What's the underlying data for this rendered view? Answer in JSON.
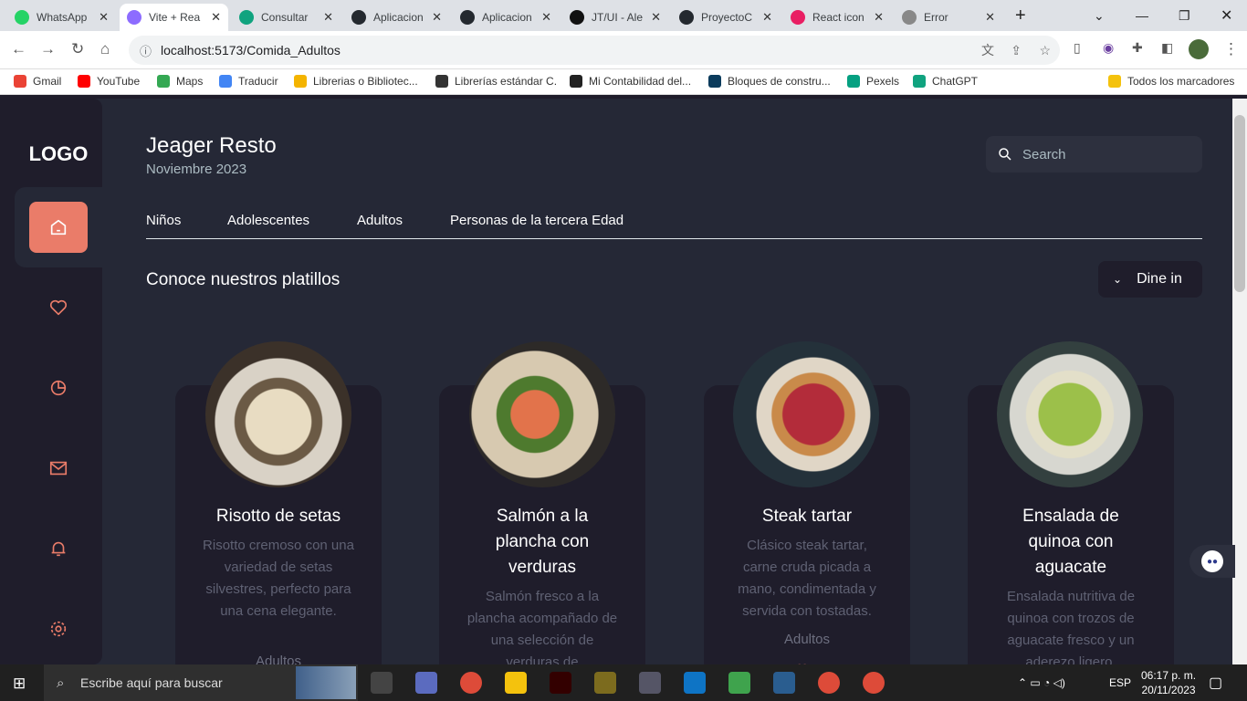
{
  "browser": {
    "tabs": [
      {
        "label": "WhatsApp",
        "color": "#25d366"
      },
      {
        "label": "Vite + Rea",
        "color": "#8d6cff"
      },
      {
        "label": "Consultar",
        "color": "#10a37f"
      },
      {
        "label": "Aplicacion",
        "color": "#24292f"
      },
      {
        "label": "Aplicacion",
        "color": "#24292f"
      },
      {
        "label": "JT/UI - Ale",
        "color": "#111111"
      },
      {
        "label": "ProyectoC",
        "color": "#24292f"
      },
      {
        "label": "React icon",
        "color": "#e91e63"
      },
      {
        "label": "Error",
        "color": "#888888"
      }
    ],
    "url": "localhost:5173/Comida_Adultos",
    "bookmarks": [
      {
        "label": "Gmail",
        "color": "#ea4335"
      },
      {
        "label": "YouTube",
        "color": "#ff0000"
      },
      {
        "label": "Maps",
        "color": "#34a853"
      },
      {
        "label": "Traducir",
        "color": "#4285f4"
      },
      {
        "label": "Librerias o Bibliotec...",
        "color": "#f4b400"
      },
      {
        "label": "Librerías estándar C.",
        "color": "#333333"
      },
      {
        "label": "Mi Contabilidad del...",
        "color": "#222222"
      },
      {
        "label": "Bloques de constru...",
        "color": "#0b3b5c"
      },
      {
        "label": "Pexels",
        "color": "#05a081"
      },
      {
        "label": "ChatGPT",
        "color": "#10a37f"
      }
    ],
    "all_bookmarks": "Todos los marcadores"
  },
  "app": {
    "logo": "LOGO",
    "title": "Jeager Resto",
    "date": "Noviembre 2023",
    "search_placeholder": "Search",
    "nav": [
      "Niños",
      "Adolescentes",
      "Adultos",
      "Personas de la tercera Edad"
    ],
    "section_title": "Conoce nuestros platillos",
    "dine_label": "Dine in",
    "dishes": [
      {
        "name": "Risotto de setas",
        "desc": "Risotto cremoso con una variedad de setas silvestres, perfecto para una cena elegante.",
        "category": "Adultos"
      },
      {
        "name": "Salmón a la plancha con verduras",
        "desc": "Salmón fresco a la plancha acompañado de una selección de verduras de",
        "category": ""
      },
      {
        "name": "Steak tartar",
        "desc": "Clásico steak tartar, carne cruda picada a mano, condimentada y servida con tostadas.",
        "category": "Adultos"
      },
      {
        "name": "Ensalada de quinoa con aguacate",
        "desc": "Ensalada nutritiva de quinoa con trozos de aguacate fresco y un aderezo ligero.",
        "category": ""
      }
    ],
    "accent": "#ea7c69"
  },
  "taskbar": {
    "search": "Escribe aquí para buscar",
    "lang": "ESP",
    "time": "06:17 p. m.",
    "date": "20/11/2023"
  }
}
